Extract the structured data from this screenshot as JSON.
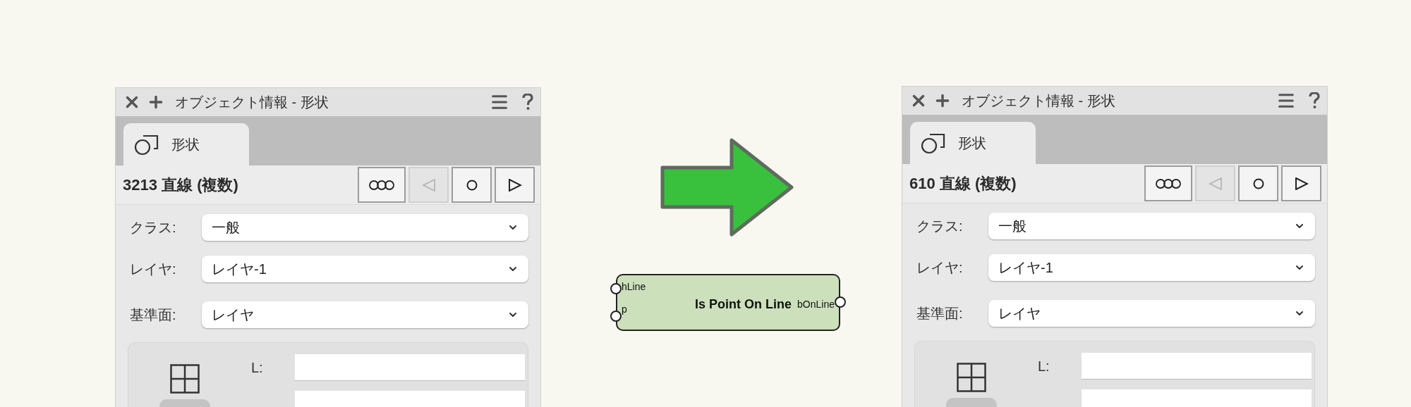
{
  "panels": [
    {
      "title": "オブジェクト情報 - 形状",
      "tabs": [
        {
          "label": "形状",
          "selected": true
        }
      ],
      "object": "3213 直線 (複数)",
      "nav_buttons": [
        {
          "kind": "group",
          "disabled": false
        },
        {
          "kind": "previous",
          "disabled": true
        },
        {
          "kind": "current",
          "disabled": false
        },
        {
          "kind": "next",
          "disabled": false
        }
      ],
      "fields": [
        {
          "label": "クラス:",
          "value": "一般"
        },
        {
          "label": "レイヤ:",
          "value": "レイヤ-1"
        },
        {
          "label": "基準面:",
          "value": "レイヤ"
        }
      ],
      "coordinate_fields": [
        {
          "kind": "labeled",
          "label": "L:"
        },
        {
          "kind": "unlabeled"
        }
      ]
    },
    {
      "title": "オブジェクト情報 - 形状",
      "tabs": [
        {
          "label": "形状",
          "selected": true
        }
      ],
      "object": "610 直線 (複数)",
      "nav_buttons": [
        {
          "kind": "group",
          "disabled": false
        },
        {
          "kind": "previous",
          "disabled": true
        },
        {
          "kind": "current",
          "disabled": false
        },
        {
          "kind": "next",
          "disabled": false
        }
      ],
      "fields": [
        {
          "label": "クラス:",
          "value": "一般"
        },
        {
          "label": "レイヤ:",
          "value": "レイヤ-1"
        },
        {
          "label": "基準面:",
          "value": "レイヤ"
        }
      ],
      "coordinate_fields": [
        {
          "kind": "labeled",
          "label": "L:"
        },
        {
          "kind": "unlabeled"
        }
      ]
    }
  ],
  "node": {
    "title": "Is Point On Line",
    "inputs": [
      "hLine",
      "p"
    ],
    "outputs": [
      "bOnLine"
    ]
  }
}
